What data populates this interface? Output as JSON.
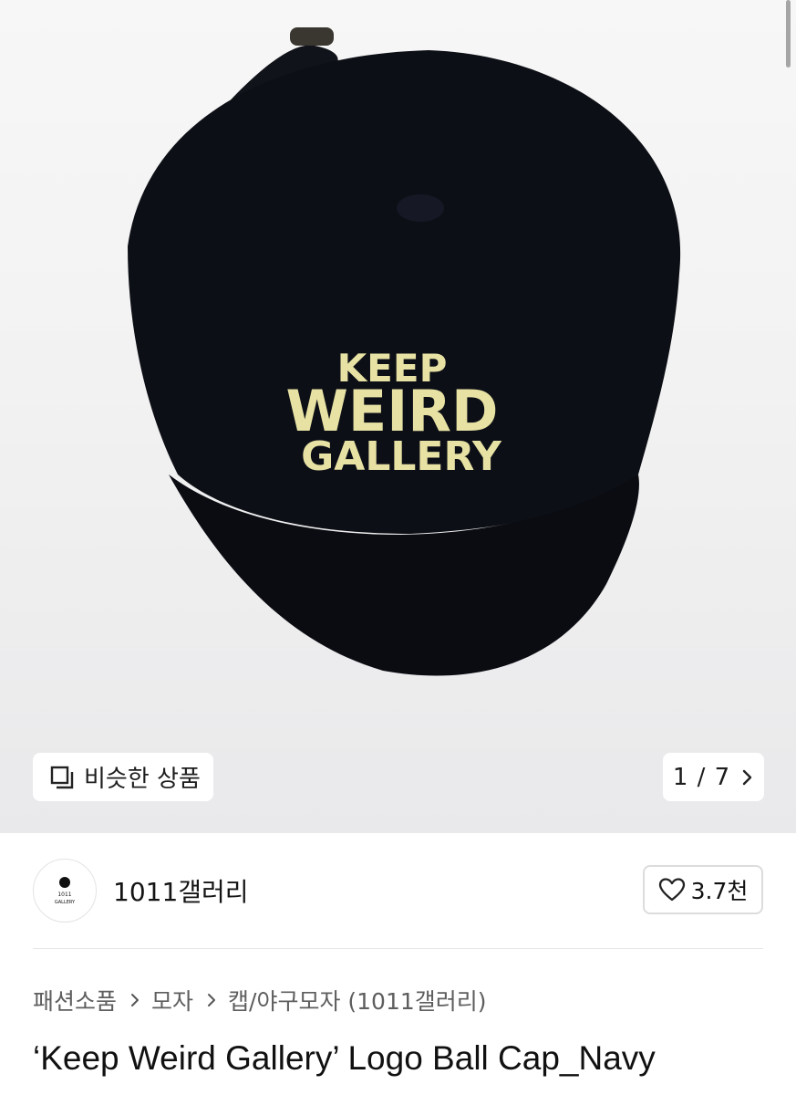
{
  "image_carousel": {
    "similar_label": "비슷한 상품",
    "counter": "1 / 7",
    "cap_logo": [
      "KEEP",
      "WEIRD",
      "GALLERY"
    ]
  },
  "seller": {
    "name": "1011갤러리",
    "avatar_text": [
      "1011",
      "GALLERY"
    ],
    "likes": "3.7천"
  },
  "breadcrumb": [
    "패션소품",
    "모자",
    "캡/야구모자 (1011갤러리)"
  ],
  "product": {
    "title": "‘Keep Weird Gallery’ Logo Ball Cap_Navy"
  },
  "colors": {
    "cap": "#0d0f16",
    "embroidery": "#e7e2a4"
  }
}
